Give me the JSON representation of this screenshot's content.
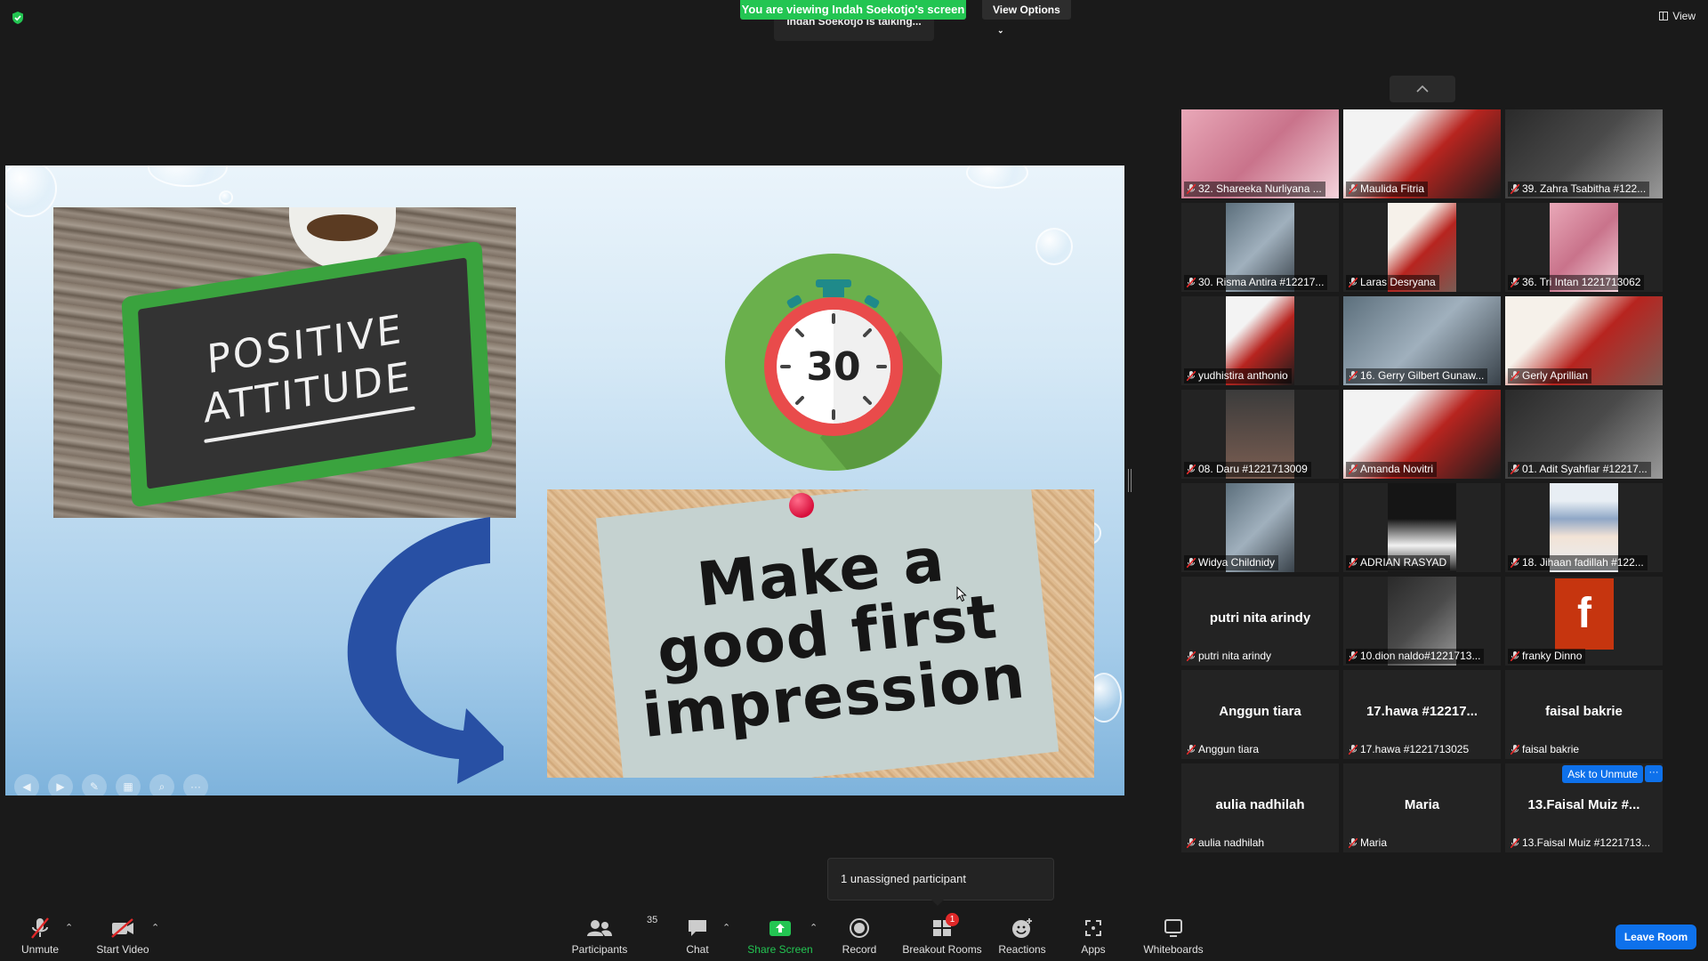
{
  "banner": {
    "viewing": "You are viewing Indah Soekotjo's screen",
    "view_options": "View Options",
    "talking": "Indah Soekotjo is talking...",
    "view": "View"
  },
  "slide": {
    "board_line1": "POSITIVE",
    "board_line2": "ATTITUDE",
    "timer_value": "30",
    "note_line1": "Make a",
    "note_line2": "good first",
    "note_line3": "impression"
  },
  "gallery": {
    "tiles": [
      {
        "name": "32. Shareeka Nurliyana ...",
        "center": "",
        "type": "video"
      },
      {
        "name": "Maulida Fitria",
        "center": "",
        "type": "video"
      },
      {
        "name": "39. Zahra Tsabitha #122...",
        "center": "",
        "type": "video"
      },
      {
        "name": "30. Risma Antira #12217...",
        "center": "",
        "type": "video"
      },
      {
        "name": "Laras Desryana",
        "center": "",
        "type": "video"
      },
      {
        "name": "36. Tri Intan 1221713062",
        "center": "",
        "type": "video"
      },
      {
        "name": "yudhistira anthonio",
        "center": "",
        "type": "video"
      },
      {
        "name": "16. Gerry Gilbert Gunaw...",
        "center": "",
        "type": "video"
      },
      {
        "name": "Gerly Aprillian",
        "center": "",
        "type": "video"
      },
      {
        "name": "08. Daru #1221713009",
        "center": "",
        "type": "video"
      },
      {
        "name": "Amanda Novitri",
        "center": "",
        "type": "video"
      },
      {
        "name": "01. Adit Syahfiar #12217...",
        "center": "",
        "type": "video"
      },
      {
        "name": "Widya Childnidy",
        "center": "",
        "type": "video"
      },
      {
        "name": "ADRIAN RASYAD",
        "center": "",
        "type": "video"
      },
      {
        "name": "18. Jihaan fadillah #122...",
        "center": "",
        "type": "video"
      },
      {
        "name": "putri nita arindy",
        "center": "putri nita arindy",
        "type": "plain"
      },
      {
        "name": "10.dion naldo#1221713...",
        "center": "",
        "type": "video"
      },
      {
        "name": "franky Dinno",
        "center": "f",
        "type": "avatar"
      },
      {
        "name": "Anggun tiara",
        "center": "Anggun tiara",
        "type": "plain"
      },
      {
        "name": "17.hawa #1221713025",
        "center": "17.hawa #12217...",
        "type": "plain"
      },
      {
        "name": "faisal bakrie",
        "center": "faisal bakrie",
        "type": "plain"
      },
      {
        "name": "aulia nadhilah",
        "center": "aulia nadhilah",
        "type": "plain"
      },
      {
        "name": "Maria",
        "center": "Maria",
        "type": "plain"
      },
      {
        "name": "13.Faisal Muiz #1221713...",
        "center": "13.Faisal Muiz #...",
        "type": "plain"
      }
    ],
    "ask_to_unmute": "Ask to Unmute",
    "more": "···"
  },
  "unassigned": "1 unassigned participant",
  "toolbar": {
    "unmute": "Unmute",
    "start_video": "Start Video",
    "participants": "Participants",
    "participants_count": "35",
    "chat": "Chat",
    "share_screen": "Share Screen",
    "record": "Record",
    "breakout_rooms": "Breakout Rooms",
    "breakout_badge": "1",
    "reactions": "Reactions",
    "apps": "Apps",
    "whiteboards": "Whiteboards",
    "leave_room": "Leave Room"
  },
  "colors": {
    "accent_green": "#23c552",
    "accent_blue": "#0e71eb",
    "muted_red": "#e02828",
    "background": "#1a1a1a"
  }
}
